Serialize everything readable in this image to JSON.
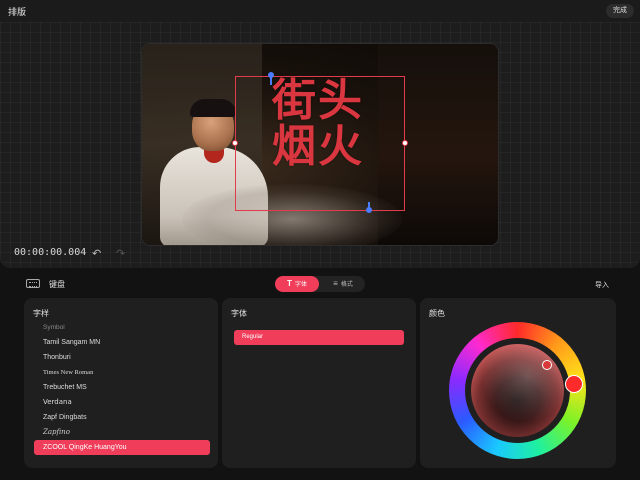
{
  "header": {
    "title": "排版",
    "done_label": "完成"
  },
  "preview": {
    "text": "街头烟火"
  },
  "playback": {
    "timecode": "00:00:00.004"
  },
  "icons": {
    "undo": "undo-icon",
    "redo": "redo-icon",
    "keyboard": "keyboard-icon"
  },
  "keyboard": {
    "label": "键盘"
  },
  "tabs": [
    {
      "icon": "T",
      "label": "字体",
      "active": true
    },
    {
      "icon": "≡",
      "label": "格式",
      "active": false
    }
  ],
  "import_label": "导入",
  "font_panel": {
    "title": "字样",
    "fonts": [
      "Symbol",
      "Tamil Sangam MN",
      "Thonburi",
      "Times New Roman",
      "Trebuchet MS",
      "Verdana",
      "Zapf Dingbats",
      "Zapfino",
      "ZCOOL QingKe HuangYou"
    ],
    "selected_font": "ZCOOL QingKe HuangYou"
  },
  "style_panel": {
    "title": "字体",
    "selected_variant": "Regular"
  },
  "color_panel": {
    "title": "颜色",
    "selected_color": "#ff2a2a"
  },
  "accent_color": "#ef3d5a"
}
